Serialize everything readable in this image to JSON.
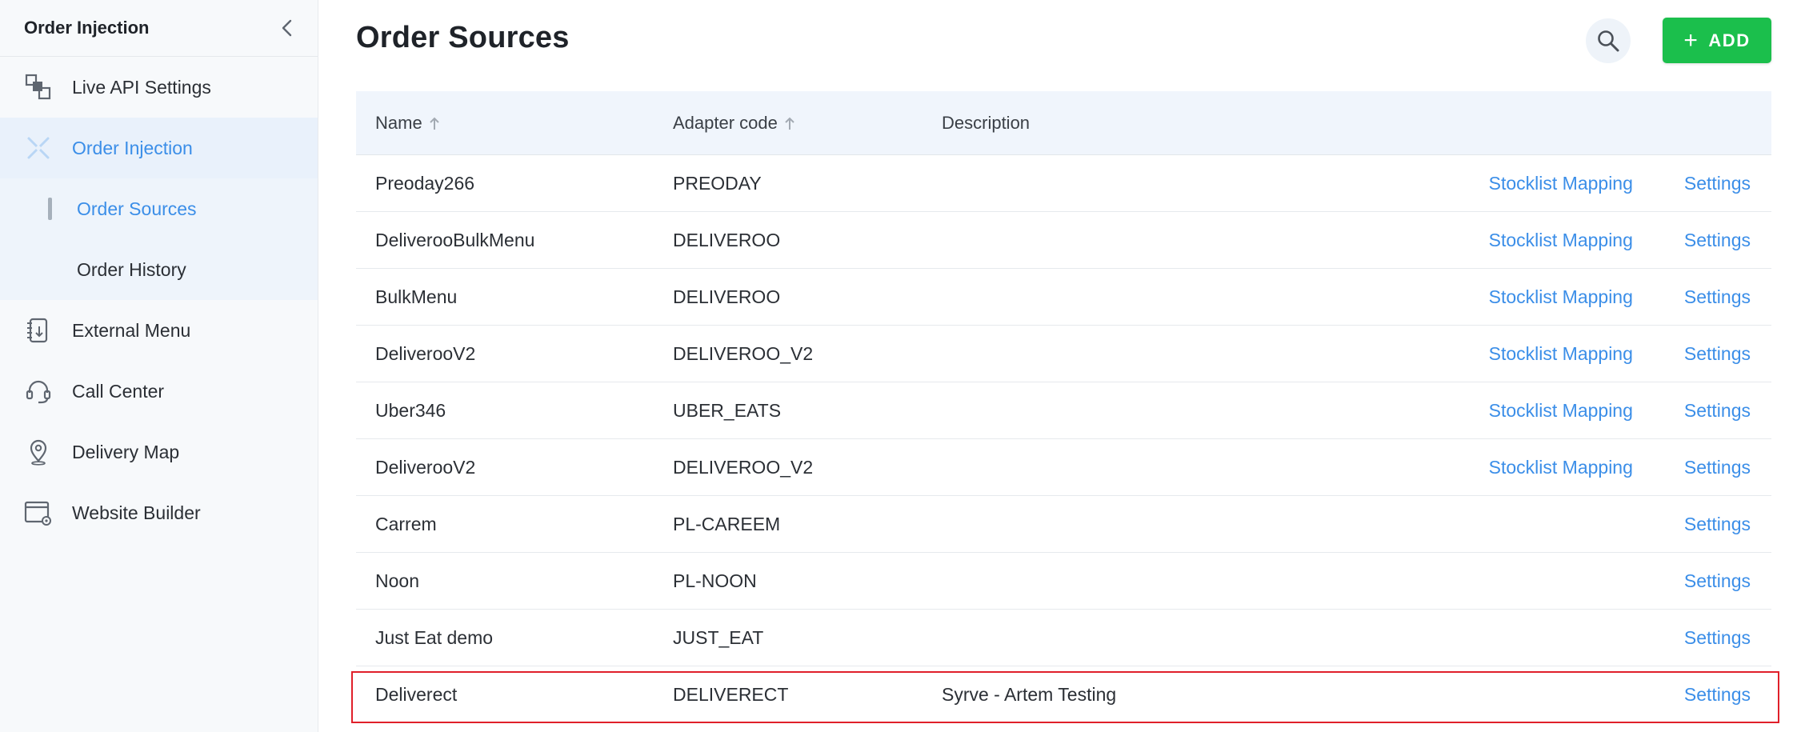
{
  "sidebar": {
    "title": "Order Injection",
    "items": [
      {
        "label": "Live API Settings",
        "icon": "api-icon"
      },
      {
        "label": "Order Injection",
        "icon": "order-injection-icon",
        "active": true
      },
      {
        "label": "External Menu",
        "icon": "external-menu-icon"
      },
      {
        "label": "Call Center",
        "icon": "headset-icon"
      },
      {
        "label": "Delivery Map",
        "icon": "map-pin-icon"
      },
      {
        "label": "Website Builder",
        "icon": "website-builder-icon"
      }
    ],
    "subitems": [
      {
        "label": "Order Sources",
        "selected": true
      },
      {
        "label": "Order History"
      }
    ]
  },
  "main": {
    "title": "Order Sources",
    "add_label": "ADD",
    "table": {
      "headers": {
        "name": "Name",
        "code": "Adapter code",
        "description": "Description"
      },
      "action_labels": {
        "stocklist": "Stocklist Mapping",
        "settings": "Settings"
      },
      "rows": [
        {
          "name": "Preoday266",
          "code": "PREODAY",
          "description": "",
          "stocklist": "Stocklist Mapping",
          "settings": "Settings"
        },
        {
          "name": "DeliverooBulkMenu",
          "code": "DELIVEROO",
          "description": "",
          "stocklist": "Stocklist Mapping",
          "settings": "Settings"
        },
        {
          "name": "BulkMenu",
          "code": "DELIVEROO",
          "description": "",
          "stocklist": "Stocklist Mapping",
          "settings": "Settings"
        },
        {
          "name": "DeliverooV2",
          "code": "DELIVEROO_V2",
          "description": "",
          "stocklist": "Stocklist Mapping",
          "settings": "Settings"
        },
        {
          "name": "Uber346",
          "code": "UBER_EATS",
          "description": "",
          "stocklist": "Stocklist Mapping",
          "settings": "Settings"
        },
        {
          "name": "DeliverooV2",
          "code": "DELIVEROO_V2",
          "description": "",
          "stocklist": "Stocklist Mapping",
          "settings": "Settings"
        },
        {
          "name": "Carrem",
          "code": "PL-CAREEM",
          "description": "",
          "stocklist": "",
          "settings": "Settings"
        },
        {
          "name": "Noon",
          "code": "PL-NOON",
          "description": "",
          "stocklist": "",
          "settings": "Settings"
        },
        {
          "name": "Just Eat demo",
          "code": "JUST_EAT",
          "description": "",
          "stocklist": "",
          "settings": "Settings"
        },
        {
          "name": "Deliverect",
          "code": "DELIVERECT",
          "description": "Syrve - Artem Testing",
          "stocklist": "",
          "settings": "Settings",
          "highlighted": true
        }
      ]
    }
  },
  "colors": {
    "accent": "#3b8ee8",
    "add_button": "#1bbf4c",
    "highlight_border": "#e0202a",
    "header_bg": "#f0f5fc"
  }
}
